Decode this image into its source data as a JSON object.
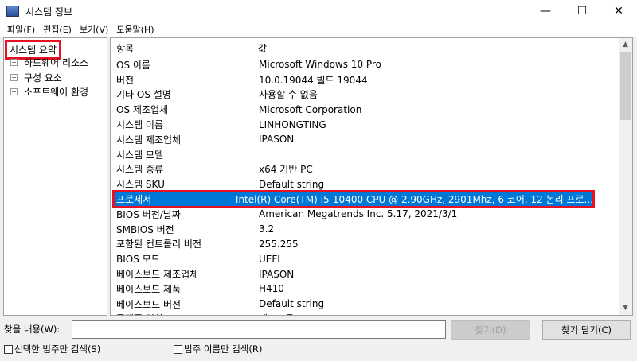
{
  "window": {
    "title": "시스템 정보"
  },
  "menu": [
    "파일(F)",
    "편집(E)",
    "보기(V)",
    "도움말(H)"
  ],
  "tree": {
    "root": "시스템 요약",
    "items": [
      "하드웨어 리소스",
      "구성 요소",
      "소프트웨어 환경"
    ]
  },
  "table": {
    "headers": [
      "항목",
      "값"
    ],
    "rows": [
      [
        "OS 이름",
        "Microsoft Windows 10 Pro"
      ],
      [
        "버전",
        "10.0.19044 빌드 19044"
      ],
      [
        "기타 OS 설명",
        "사용할 수 없음"
      ],
      [
        "OS 제조업체",
        "Microsoft Corporation"
      ],
      [
        "시스템 이름",
        "LINHONGTING"
      ],
      [
        "시스템 제조업체",
        "IPASON"
      ],
      [
        "시스템 모델",
        ""
      ],
      [
        "시스템 종류",
        "x64 기반 PC"
      ],
      [
        "시스템 SKU",
        "Default string"
      ],
      [
        "프로세서",
        "Intel(R) Core(TM) i5-10400 CPU @ 2.90GHz, 2901Mhz, 6 코어, 12 논리 프로..."
      ],
      [
        "BIOS 버전/날짜",
        "American Megatrends Inc. 5.17, 2021/3/1"
      ],
      [
        "SMBIOS 버전",
        "3.2"
      ],
      [
        "포함된 컨트롤러 버전",
        "255.255"
      ],
      [
        "BIOS 모드",
        "UEFI"
      ],
      [
        "베이스보드 제조업체",
        "IPASON"
      ],
      [
        "베이스보드 제품",
        "H410"
      ],
      [
        "베이스보드 버전",
        "Default string"
      ],
      [
        "플랫폼 역할",
        "데스크톱"
      ]
    ],
    "selected_index": 9
  },
  "find": {
    "label": "찾을 내용(W):",
    "value": "",
    "find_button": "찾기(D)",
    "close_button": "찾기 닫기(C)",
    "check_selected": "선택한 범주만 검색(S)",
    "check_names": "범주 이름만 검색(R)"
  }
}
